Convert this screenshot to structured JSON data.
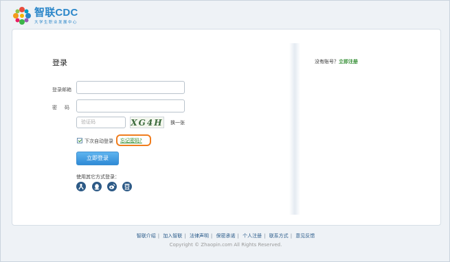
{
  "header": {
    "brand": "智联CDC",
    "subtitle": "大学生职业发展中心"
  },
  "login": {
    "title": "登录",
    "email_label": "登录邮箱",
    "password_label": "密码",
    "email_value": "",
    "password_value": "",
    "captcha_placeholder": "验证码",
    "captcha_text": "XG4H",
    "refresh_label": "换一张",
    "remember_label": "下次自动登录",
    "remember_checked": true,
    "forgot_label": "忘记密码?",
    "submit_label": "立即登录",
    "other_methods_label": "使用其它方式登录：",
    "social_icons": [
      "renren-icon",
      "qq-icon",
      "weibo-icon",
      "douban-icon"
    ]
  },
  "signup": {
    "prompt": "没有账号？",
    "link_label": "立即注册"
  },
  "footer": {
    "links": [
      "智联介绍",
      "加入智联",
      "法律声明",
      "保密承诺",
      "个人注册",
      "联系方式",
      "意见反馈"
    ],
    "copyright": "Copyright © Zhaopin.com All Rights Reserved."
  },
  "colors": {
    "brand_blue": "#2a86c9",
    "accent_green": "#2e8b2e",
    "highlight_orange": "#f07c1c",
    "button_blue": "#2f8ad6"
  }
}
